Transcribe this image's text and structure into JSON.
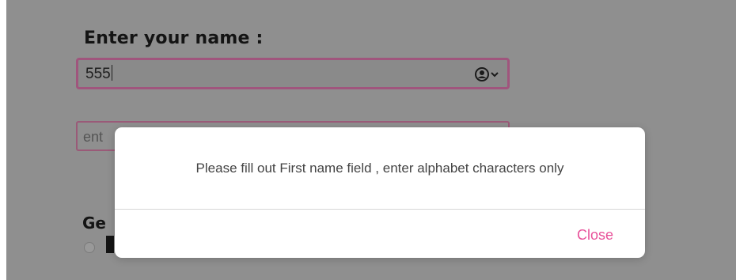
{
  "form": {
    "name_label": "Enter your name :",
    "name_value": "555",
    "second_placeholder": "ent",
    "gender_label": "Ge"
  },
  "dialog": {
    "message": "Please fill out First name field , enter alphabet characters only",
    "close_label": "Close",
    "accent_color": "#e8529a"
  },
  "icons": {
    "autofill": "contact-autofill-icon"
  }
}
